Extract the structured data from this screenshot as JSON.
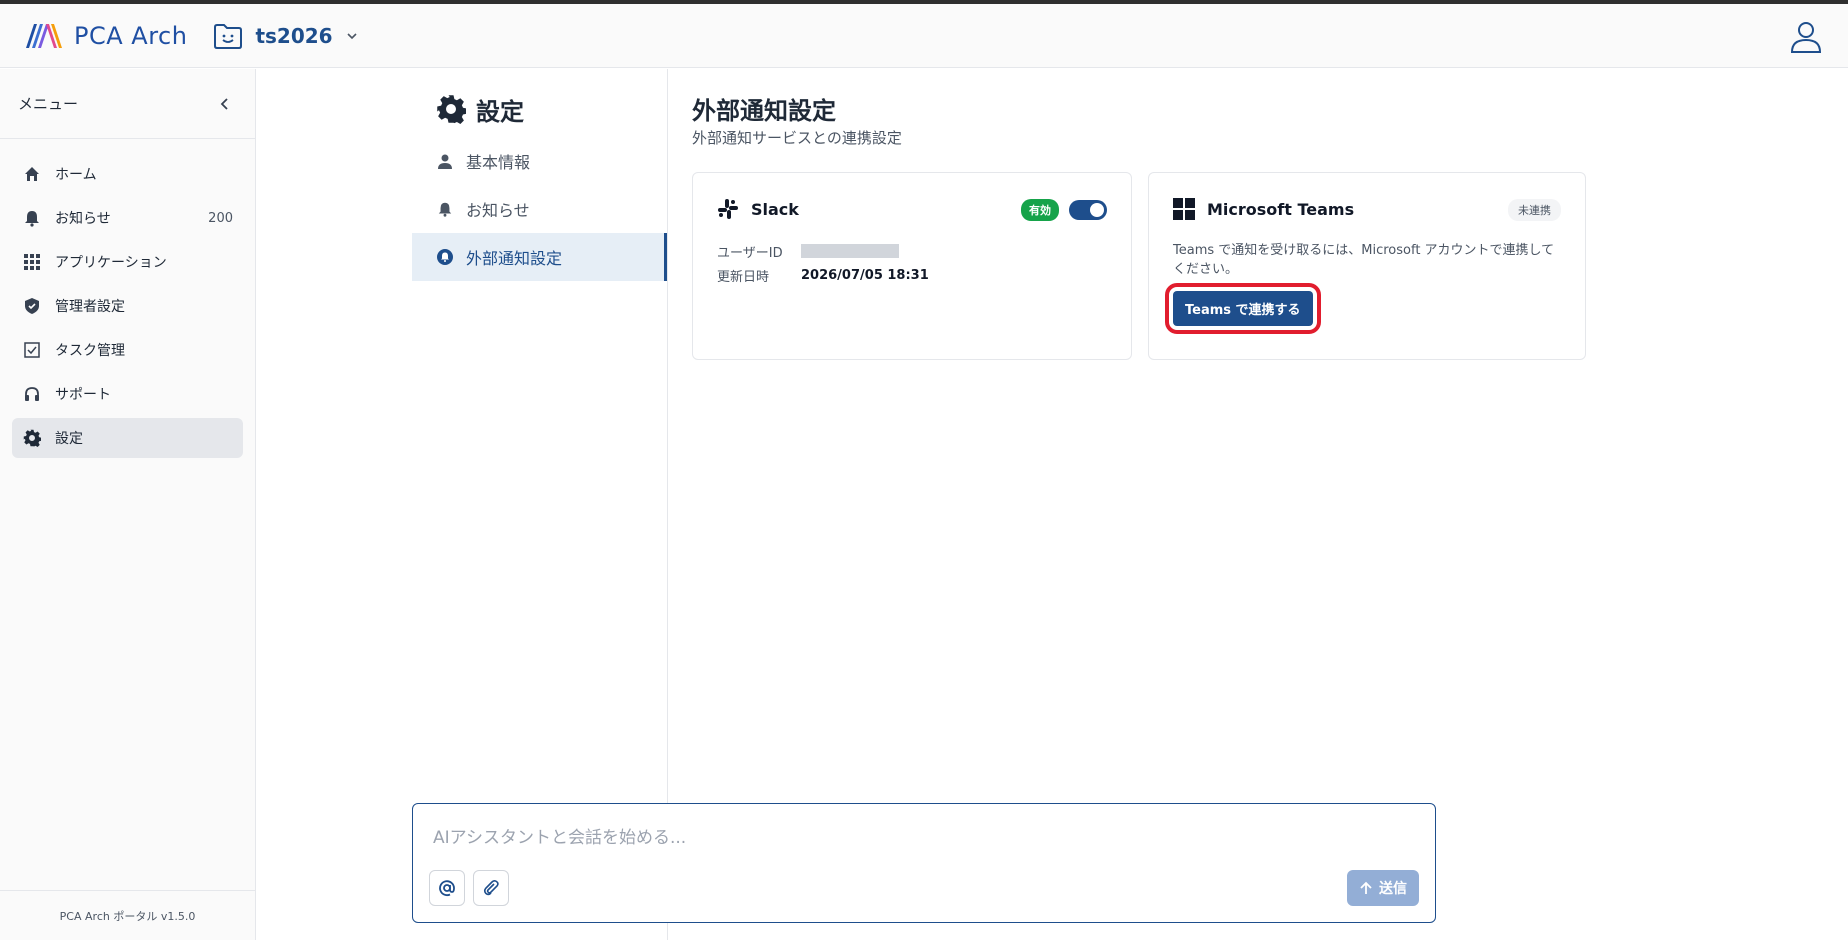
{
  "header": {
    "app_name": "PCA Arch",
    "workspace": "ts2026"
  },
  "sidebar": {
    "title": "メニュー",
    "items": [
      {
        "label": "ホーム",
        "icon": "home-icon"
      },
      {
        "label": "お知らせ",
        "icon": "bell-icon",
        "count": "200"
      },
      {
        "label": "アプリケーション",
        "icon": "grid-icon"
      },
      {
        "label": "管理者設定",
        "icon": "shield-icon"
      },
      {
        "label": "タスク管理",
        "icon": "checkbox-icon"
      },
      {
        "label": "サポート",
        "icon": "headset-icon"
      },
      {
        "label": "設定",
        "icon": "gear-icon",
        "active": true
      }
    ],
    "footer": "PCA Arch ポータル v1.5.0"
  },
  "settings_nav": {
    "title": "設定",
    "items": [
      {
        "label": "基本情報",
        "icon": "person-icon"
      },
      {
        "label": "お知らせ",
        "icon": "bell-icon"
      },
      {
        "label": "外部通知設定",
        "icon": "bell-circle-icon",
        "active": true
      }
    ]
  },
  "main": {
    "title": "外部通知設定",
    "subtitle": "外部通知サービスとの連携設定",
    "slack": {
      "name": "Slack",
      "badge": "有効",
      "enabled": true,
      "user_id_label": "ユーザーID",
      "updated_label": "更新日時",
      "updated_value": "2026/07/05 18:31"
    },
    "teams": {
      "name": "Microsoft Teams",
      "badge": "未連携",
      "description": "Teams で通知を受け取るには、Microsoft アカウントで連携してください。",
      "button": "Teams で連携する"
    }
  },
  "chat": {
    "placeholder": "AIアシスタントと会話を始める...",
    "send_label": "送信"
  },
  "colors": {
    "primary": "#1e4e8c",
    "success": "#16a34a",
    "highlight": "#e11d2e"
  }
}
